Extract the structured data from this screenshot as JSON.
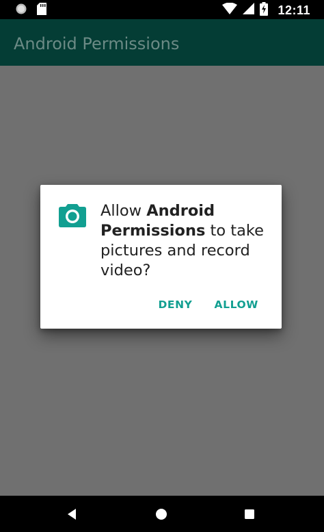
{
  "status_bar": {
    "time": "12:11",
    "icons": [
      "notification-dot-icon",
      "sd-card-icon",
      "wifi-icon",
      "cell-signal-icon",
      "battery-charging-icon"
    ]
  },
  "app_bar": {
    "title": "Android Permissions"
  },
  "dialog": {
    "icon": "camera-icon",
    "message_prefix": "Allow ",
    "app_name": "Android Permissions",
    "message_suffix": " to take pictures and record video?",
    "deny_label": "DENY",
    "allow_label": "ALLOW"
  },
  "nav_bar": {
    "icons": [
      "back-icon",
      "home-icon",
      "recents-icon"
    ]
  },
  "colors": {
    "accent": "#129f91",
    "app_bar_dimmed": "#043d35",
    "scrim": "#707070"
  }
}
